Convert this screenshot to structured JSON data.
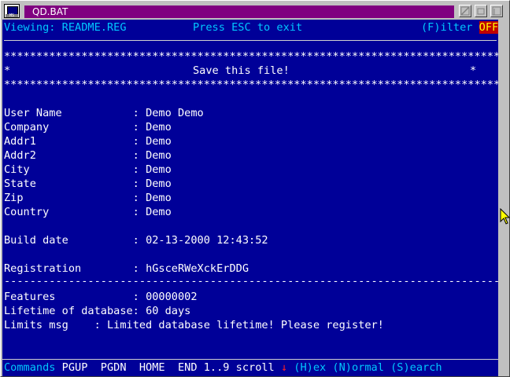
{
  "window": {
    "title": "QD.BAT",
    "icon_label": "MS"
  },
  "header": {
    "viewing": "Viewing: README.REG",
    "press_esc": "Press ESC to exit",
    "filter_label": "(F)ilter",
    "filter_state": "OFF"
  },
  "banner": {
    "stars": "*****************************************************************************",
    "left_star": "*",
    "message": "Save this file!",
    "right_star": "*"
  },
  "fields": [
    {
      "label": "User Name           : ",
      "value": "Demo Demo"
    },
    {
      "label": "Company             : ",
      "value": "Demo"
    },
    {
      "label": "Addr1               : ",
      "value": "Demo"
    },
    {
      "label": "Addr2               : ",
      "value": "Demo"
    },
    {
      "label": "City                : ",
      "value": "Demo"
    },
    {
      "label": "State               : ",
      "value": "Demo"
    },
    {
      "label": "Zip                 : ",
      "value": "Demo"
    },
    {
      "label": "Country             : ",
      "value": "Demo"
    }
  ],
  "build": {
    "label": "Build date          : ",
    "value": "02-13-2000 12:43:52"
  },
  "registration": {
    "label": "Registration        : ",
    "value": "hGsceRWeXckErDDG"
  },
  "divider": "-----------------------------------------------------------------------------",
  "features": {
    "label": "Features            : ",
    "value": "00000002"
  },
  "lifetime": {
    "label": "Lifetime of database: ",
    "value": "60 days"
  },
  "limits": {
    "label": "Limits msg    : ",
    "value": "Limited database lifetime! Please register!"
  },
  "status": {
    "commands": "Commands",
    "keys": " PGUP  PGDN  HOME  END 1..9 scroll ",
    "arrow": "↓",
    "hex": " (H)ex",
    "normal": " (N)ormal",
    "search": " (S)earch"
  }
}
